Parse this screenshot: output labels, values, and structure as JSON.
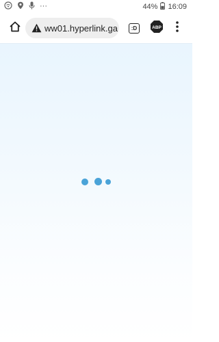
{
  "status_bar": {
    "battery_percent": "44%",
    "time": "16:09",
    "more_indicator": "···",
    "icons": [
      "wifi-calling-icon",
      "location-icon",
      "microphone-icon",
      "battery-icon"
    ]
  },
  "toolbar": {
    "url": "ww01.hyperlink.ga",
    "security_state": "not-secure-warning-icon",
    "extension_1_label": ":D",
    "extension_2_label": "ABP"
  },
  "content": {
    "state": "loading",
    "loader_color": "#4aa3d8"
  },
  "colors": {
    "omnibox_bg": "#eeeeee",
    "page_bg_top": "#e9f5fe",
    "page_bg_bottom": "#ffffff"
  }
}
